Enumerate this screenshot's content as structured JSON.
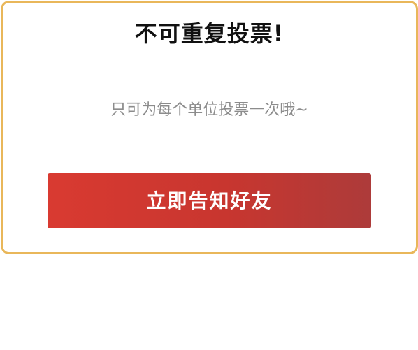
{
  "dialog": {
    "title": "不可重复投票!",
    "message": "只可为每个单位投票一次哦~",
    "share_button_label": "立即告知好友"
  },
  "colors": {
    "border": "#e9b75a",
    "button_start": "#d93a31",
    "button_end": "#ad3b3a",
    "title_text": "#111111",
    "message_text": "#8c8c8c"
  }
}
